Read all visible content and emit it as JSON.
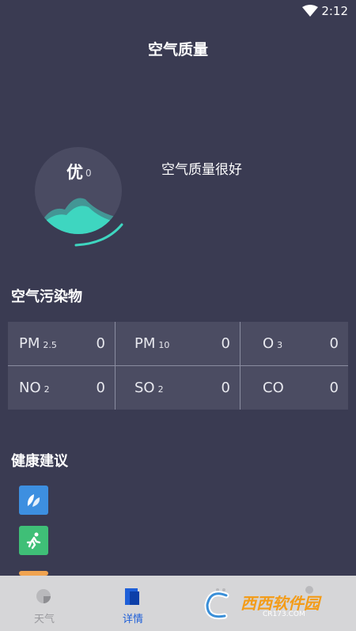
{
  "status_bar": {
    "time": "2:12"
  },
  "header": {
    "title": "空气质量"
  },
  "aqi": {
    "level": "优",
    "value": "0",
    "description": "空气质量很好"
  },
  "pollutants": {
    "title": "空气污染物",
    "items": [
      {
        "name": "PM",
        "sub": "2.5",
        "value": "0"
      },
      {
        "name": "PM",
        "sub": "10",
        "value": "0"
      },
      {
        "name": "O",
        "sub": "3",
        "value": "0"
      },
      {
        "name": "NO",
        "sub": "2",
        "value": "0"
      },
      {
        "name": "SO",
        "sub": "2",
        "value": "0"
      },
      {
        "name": "CO",
        "sub": "",
        "value": "0"
      }
    ]
  },
  "health": {
    "title": "健康建议",
    "icons": [
      "leaf-icon",
      "running-person-icon",
      "advice-icon"
    ]
  },
  "tabs": [
    {
      "label": "天气",
      "icon": "weather-icon",
      "active": false
    },
    {
      "label": "详情",
      "icon": "details-icon",
      "active": true
    },
    {
      "label": "",
      "icon": "tab-icon",
      "active": false
    },
    {
      "label": "",
      "icon": "settings-icon",
      "active": false
    }
  ],
  "watermark": {
    "text": "西西软件园",
    "sub": "CR173.COM"
  },
  "colors": {
    "background": "#3a3b52",
    "grid_background": "#4b4c62",
    "gauge_wave": "#3ed6c0",
    "advice_blue": "#3d8fe0",
    "advice_green": "#3fbf77",
    "advice_orange": "#f0a350",
    "tab_active": "#1e5fd8",
    "tabbar": "#d6d6d8"
  }
}
